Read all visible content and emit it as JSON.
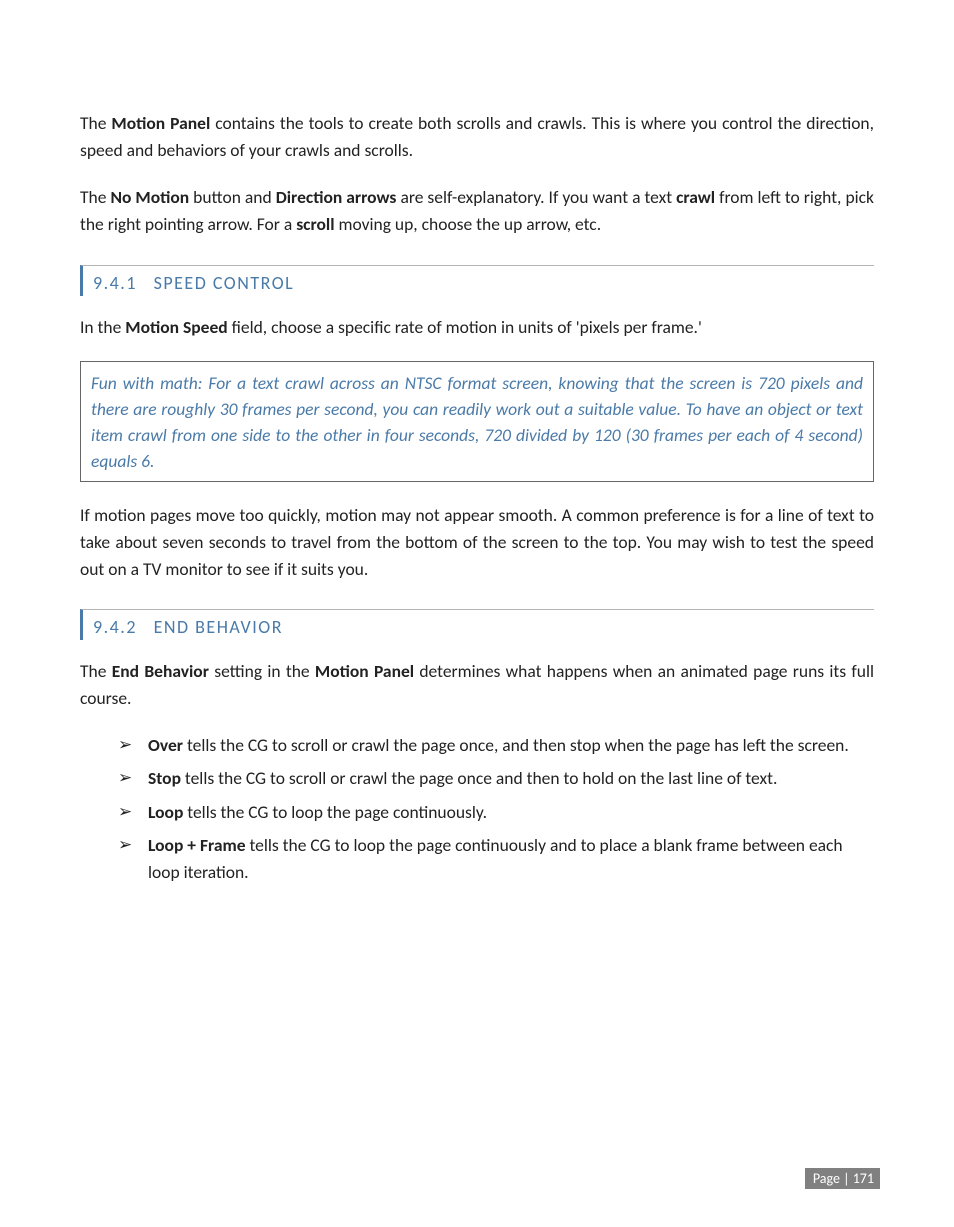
{
  "intro": {
    "p1_a": "The ",
    "p1_b": "Motion Panel",
    "p1_c": " contains the tools to create both scrolls and crawls.  This is where you control the direction, speed and behaviors of your crawls and scrolls.",
    "p2_a": "The ",
    "p2_b": "No Motion",
    "p2_c": " button and ",
    "p2_d": "Direction arrows",
    "p2_e": " are self-explanatory. If you want a text ",
    "p2_f": "crawl",
    "p2_g": " from left to right, pick the right pointing arrow. For a ",
    "p2_h": "scroll",
    "p2_i": " moving up, choose the up arrow, etc."
  },
  "section1": {
    "num": "9.4.1",
    "title": "SPEED CONTROL",
    "p1_a": "In the ",
    "p1_b": "Motion Speed",
    "p1_c": " field, choose a specific rate of motion in units of 'pixels per frame.'",
    "callout": "Fun with math: For a text crawl across an NTSC format screen, knowing that the screen is 720 pixels and there are roughly 30 frames per second, you can readily work out a suitable value.  To have an object or text item crawl from one side to the other in four seconds, 720 divided by 120 (30 frames per each of 4 second) equals 6.",
    "p2": "If motion pages move too quickly, motion may not appear smooth. A common preference is for a line of text to take about seven seconds to travel from the bottom of the screen to the top. You may wish to test the speed out on a TV monitor to see if it suits you."
  },
  "section2": {
    "num": "9.4.2",
    "title": "END BEHAVIOR",
    "p1_a": "The ",
    "p1_b": "End Behavior",
    "p1_c": " setting in the ",
    "p1_d": "Motion Panel",
    "p1_e": " determines what happens when an animated page runs its full course.",
    "items": [
      {
        "term": "Over",
        "rest": " tells the CG to scroll or crawl the page once, and then stop when the page has left the screen."
      },
      {
        "term": "Stop",
        "rest": " tells the CG to scroll or crawl the page once and then to hold on the last line of text."
      },
      {
        "term": "Loop",
        "rest": " tells the CG to loop the page continuously."
      },
      {
        "term": "Loop + Frame",
        "rest": " tells the CG to loop the page continuously and to place a blank frame between each loop iteration."
      }
    ]
  },
  "footer": {
    "label": "Page | 171"
  }
}
